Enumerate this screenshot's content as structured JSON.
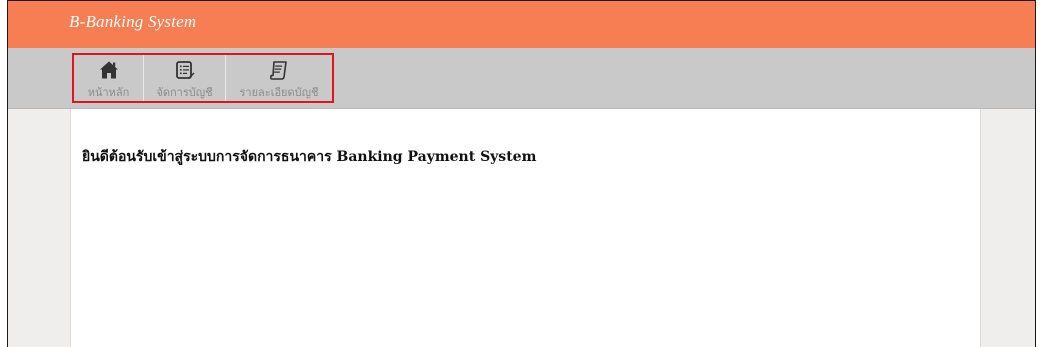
{
  "header": {
    "title": "B-Banking System",
    "background_color": "#f77d52"
  },
  "nav": {
    "items": [
      {
        "label": "หน้าหลัก",
        "icon": "home-icon"
      },
      {
        "label": "จัดการบัญชี",
        "icon": "manage-list-icon"
      },
      {
        "label": "รายละเอียดบัญชี",
        "icon": "account-detail-icon"
      }
    ],
    "highlight_color": "#e0141e"
  },
  "main": {
    "welcome_text": "ยินดีต้อนรับเข้าสู่ระบบการจัดการธนาคาร Banking Payment System"
  }
}
